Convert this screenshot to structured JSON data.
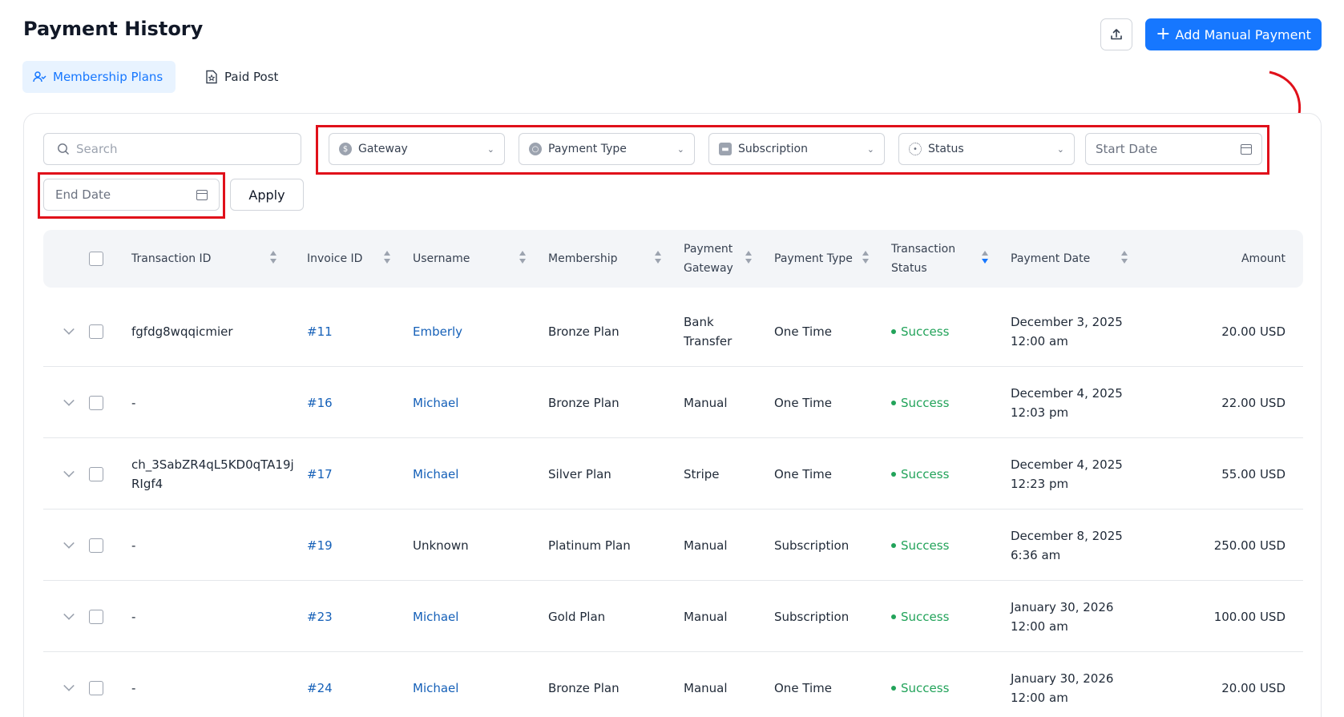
{
  "page": {
    "title": "Payment History"
  },
  "header": {
    "add_button": "Add Manual Payment"
  },
  "tabs": [
    {
      "label": "Membership Plans",
      "active": true
    },
    {
      "label": "Paid Post",
      "active": false
    }
  ],
  "filters": {
    "search_placeholder": "Search",
    "gateway": "Gateway",
    "payment_type": "Payment Type",
    "subscription": "Subscription",
    "status": "Status",
    "start_date": "Start Date",
    "end_date": "End Date",
    "apply": "Apply"
  },
  "table": {
    "columns": {
      "transaction_id": "Transaction ID",
      "invoice_id": "Invoice ID",
      "username": "Username",
      "membership": "Membership",
      "payment_gateway_1": "Payment",
      "payment_gateway_2": "Gateway",
      "payment_type": "Payment Type",
      "transaction_status_1": "Transaction",
      "transaction_status_2": "Status",
      "payment_date": "Payment Date",
      "amount": "Amount"
    },
    "rows": [
      {
        "transaction_id": "fgfdg8wqqicmier",
        "transaction_id_2": "",
        "invoice": "#11",
        "username": "Emberly",
        "membership": "Bronze Plan",
        "gateway": "Bank",
        "gateway_2": "Transfer",
        "payment_type": "One Time",
        "status": "Success",
        "date": "December 3, 2025",
        "time": "12:00 am",
        "amount": "20.00 USD"
      },
      {
        "transaction_id": "-",
        "transaction_id_2": "",
        "invoice": "#16",
        "username": "Michael",
        "membership": "Bronze Plan",
        "gateway": "Manual",
        "gateway_2": "",
        "payment_type": "One Time",
        "status": "Success",
        "date": "December 4, 2025",
        "time": "12:03 pm",
        "amount": "22.00 USD"
      },
      {
        "transaction_id": "ch_3SabZR4qL5KD0qTA19j",
        "transaction_id_2": "RIgf4",
        "invoice": "#17",
        "username": "Michael",
        "membership": "Silver Plan",
        "gateway": "Stripe",
        "gateway_2": "",
        "payment_type": "One Time",
        "status": "Success",
        "date": "December 4, 2025",
        "time": "12:23 pm",
        "amount": "55.00 USD"
      },
      {
        "transaction_id": "-",
        "transaction_id_2": "",
        "invoice": "#19",
        "username": "Unknown",
        "membership": "Platinum Plan",
        "gateway": "Manual",
        "gateway_2": "",
        "payment_type": "Subscription",
        "status": "Success",
        "date": "December 8, 2025",
        "time": "6:36 am",
        "amount": "250.00 USD"
      },
      {
        "transaction_id": "-",
        "transaction_id_2": "",
        "invoice": "#23",
        "username": "Michael",
        "membership": "Gold Plan",
        "gateway": "Manual",
        "gateway_2": "",
        "payment_type": "Subscription",
        "status": "Success",
        "date": "January 30, 2026",
        "time": "12:00 am",
        "amount": "100.00 USD"
      },
      {
        "transaction_id": "-",
        "transaction_id_2": "",
        "invoice": "#24",
        "username": "Michael",
        "membership": "Bronze Plan",
        "gateway": "Manual",
        "gateway_2": "",
        "payment_type": "One Time",
        "status": "Success",
        "date": "January 30, 2026",
        "time": "12:00 am",
        "amount": "20.00 USD"
      }
    ]
  },
  "colors": {
    "accent": "#1677ff",
    "success": "#22a35a",
    "highlight": "#e0101a",
    "link": "#1560b8"
  }
}
